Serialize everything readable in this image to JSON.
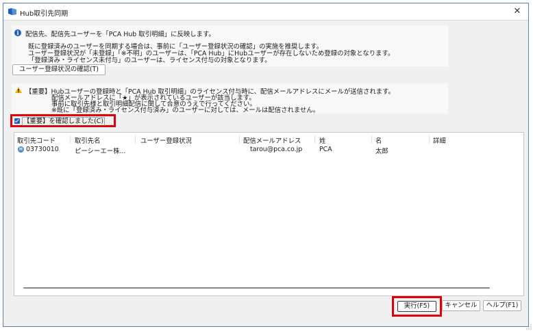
{
  "window": {
    "title": "Hub取引先同期",
    "close_symbol": "✕"
  },
  "info": {
    "icon_symbol": "i",
    "lines": [
      "配信先、配信先ユーザーを「PCA Hub 取引明細」に反映します。",
      "既に登録済みのユーザーを同期する場合は、事前に「ユーザー登録状況の確認」の実施を推奨します。",
      "ユーザー登録状況が「未登録」「※不明」のユーザーは、「PCA Hub」にHubユーザーが存在しないため登録の対象となります。",
      "「登録済み・ライセンス未付与」のユーザーは、ライセンス付与の対象となります。"
    ]
  },
  "buttons": {
    "confirm_status": "ユーザー登録状況の確認(T)",
    "run": "実行(F5)",
    "cancel": "キャンセル",
    "help": "ヘルプ(F1)"
  },
  "warning": {
    "lines": [
      "【重要】Hubユーザーの登録時と「PCA Hub 取引明細」のライセンス付与時に、配信メールアドレスにメールが送信されます。",
      "配信メールアドレスに「★」が表示されているユーザーが該当します。",
      "事前に取引先様と取引明細配信に関して合意のうえで行ってください。",
      "※既に「登録済み・ライセンス付与済み」のユーザーに対しては、メールは配信されません。"
    ]
  },
  "checkbox": {
    "label": "【重要】を確認しました(C)",
    "checked": true
  },
  "table": {
    "columns": [
      "取引先コード",
      "取引先名",
      "ユーザー登録状況",
      "配信メールアドレス",
      "姓",
      "名",
      "詳細"
    ],
    "rows": [
      {
        "icon_label": "H",
        "code": "03730010",
        "name": "ピーシーエー株...",
        "status": "",
        "email": "tarou@pca.co.jp",
        "last_name": "PCA",
        "first_name": "太郎",
        "detail": ""
      }
    ]
  },
  "colors": {
    "accent": "#1f5fb8",
    "highlight_border": "#e0000a",
    "warning": "#f2b300"
  },
  "icons": {
    "app": "hub-window-icon",
    "info": "info-icon",
    "warning": "warning-triangle-icon",
    "row": "hub-user-icon"
  }
}
